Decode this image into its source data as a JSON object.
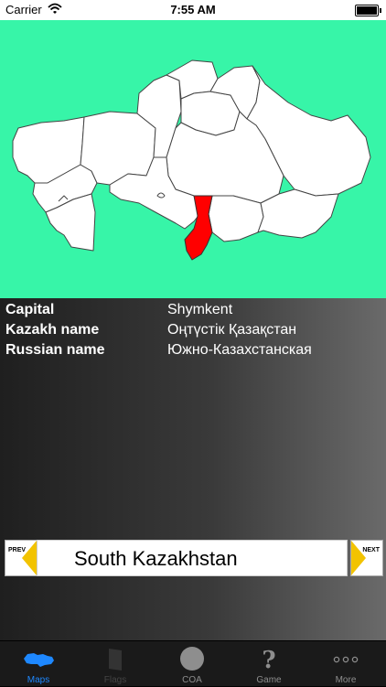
{
  "status_bar": {
    "carrier": "Carrier",
    "time": "7:55 AM"
  },
  "info": [
    {
      "key": "Capital",
      "value": "Shymkent"
    },
    {
      "key": "Kazakh name",
      "value": "Оңтүстік Қазақстан"
    },
    {
      "key": "Russian name",
      "value": "Южно-Казахстанская"
    }
  ],
  "nav": {
    "prev_label": "PREV",
    "next_label": "NEXT",
    "region_name": "South Kazakhstan",
    "arrow_color": "#f2c300"
  },
  "map": {
    "background": "#37f5a8",
    "highlight_color": "#ff0000",
    "region_color": "#ffffff"
  },
  "tabs": [
    {
      "label": "Maps",
      "icon": "map-icon",
      "state": "active"
    },
    {
      "label": "Flags",
      "icon": "flag-icon",
      "state": "disabled"
    },
    {
      "label": "COA",
      "icon": "coat-of-arms-icon",
      "state": "normal"
    },
    {
      "label": "Game",
      "icon": "question-mark-icon",
      "state": "normal"
    },
    {
      "label": "More",
      "icon": "more-icon",
      "state": "normal"
    }
  ]
}
